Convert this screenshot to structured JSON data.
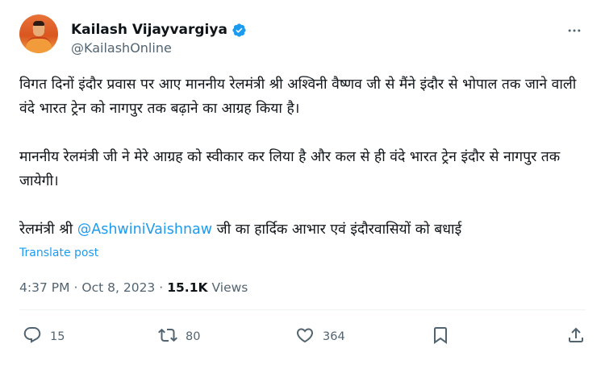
{
  "author": {
    "name": "Kailash Vijayvargiya",
    "handle": "@KailashOnline",
    "verified": true
  },
  "tweet": {
    "paragraphs": [
      "विगत दिनों इंदौर प्रवास पर आए माननीय रेलमंत्री श्री अश्विनी वैष्णव जी से मैंने इंदौर से भोपाल तक जाने वाली वंदे भारत ट्रेन को नागपुर तक बढ़ाने का आग्रह किया है।",
      "माननीय रेलमंत्री जी ने मेरे आग्रह को स्वीकार कर लिया है और कल से ही वंदे भारत ट्रेन इंदौर से नागपुर तक जायेगी।"
    ],
    "last_paragraph": {
      "before": "रेलमंत्री श्री ",
      "mention": "@AshwiniVaishnaw",
      "after": " जी का हार्दिक आभार एवं इंदौरवासियों को बधाई"
    },
    "translate_label": "Translate post"
  },
  "meta": {
    "time": "4:37 PM",
    "separator": "·",
    "date": "Oct 8, 2023",
    "views_count": "15.1K",
    "views_label": "Views"
  },
  "actions": {
    "replies": "15",
    "reposts": "80",
    "likes": "364"
  },
  "colors": {
    "accent": "#1d9bf0",
    "secondary_text": "#536471",
    "primary_text": "#0f1419"
  },
  "icons": [
    "more-icon",
    "verified-badge-icon",
    "reply-icon",
    "repost-icon",
    "like-icon",
    "bookmark-icon",
    "share-icon"
  ]
}
